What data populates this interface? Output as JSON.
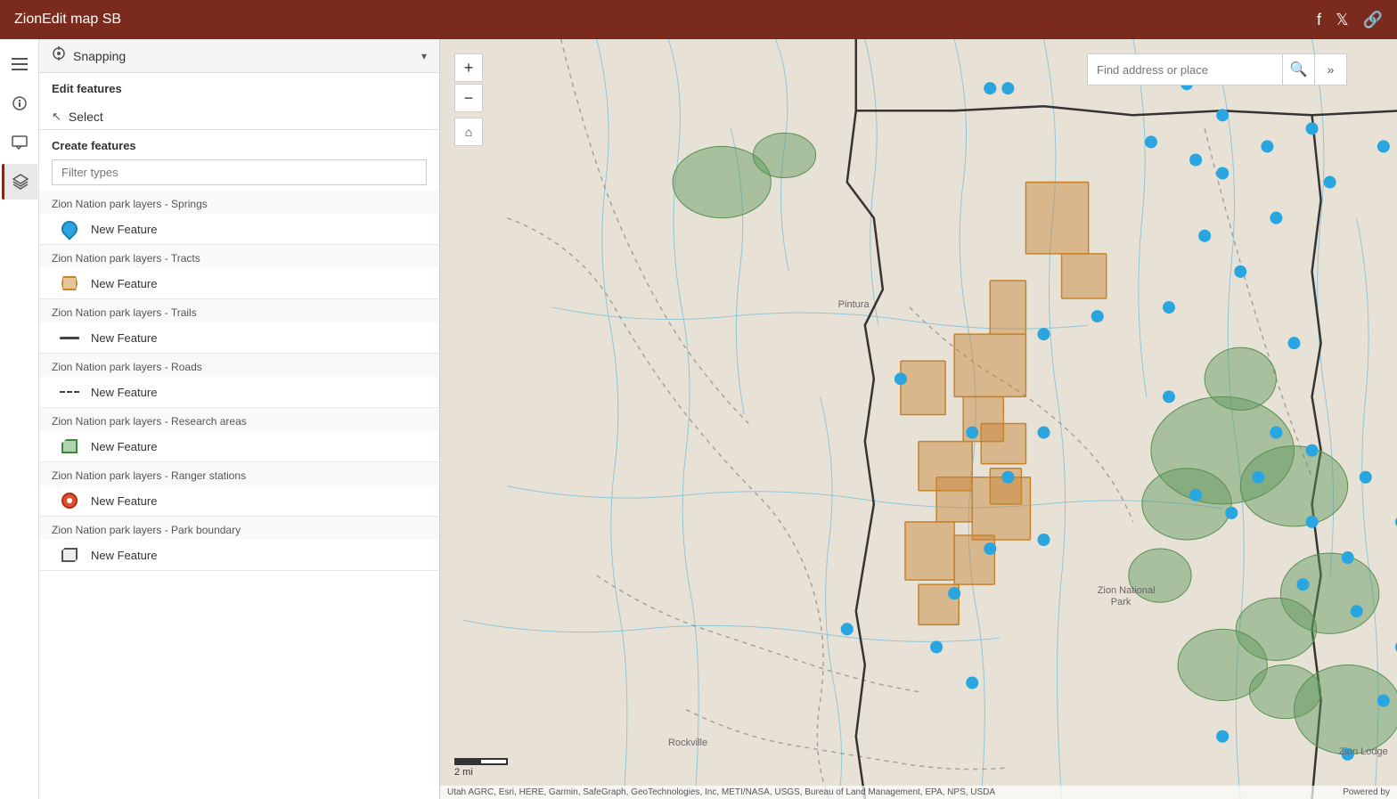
{
  "app": {
    "title": "ZionEdit map SB"
  },
  "topbar": {
    "title": "ZionEdit map SB",
    "icons": [
      "facebook",
      "twitter",
      "share"
    ]
  },
  "sidebar_icons": [
    {
      "name": "list-icon",
      "symbol": "☰"
    },
    {
      "name": "info-icon",
      "symbol": "ℹ"
    },
    {
      "name": "comment-icon",
      "symbol": "▭"
    },
    {
      "name": "layers-icon",
      "symbol": "⧉"
    }
  ],
  "panel": {
    "snapping_label": "Snapping",
    "edit_features_title": "Edit features",
    "select_label": "Select",
    "create_features_title": "Create features",
    "filter_placeholder": "Filter types",
    "layer_groups": [
      {
        "title": "Zion Nation park layers - Springs",
        "feature_label": "New Feature",
        "icon_type": "point"
      },
      {
        "title": "Zion Nation park layers - Tracts",
        "feature_label": "New Feature",
        "icon_type": "polygon-orange"
      },
      {
        "title": "Zion Nation park layers - Trails",
        "feature_label": "New Feature",
        "icon_type": "line-solid"
      },
      {
        "title": "Zion Nation park layers - Roads",
        "feature_label": "New Feature",
        "icon_type": "line-dashed"
      },
      {
        "title": "Zion Nation park layers - Research areas",
        "feature_label": "New Feature",
        "icon_type": "polygon-green"
      },
      {
        "title": "Zion Nation park layers - Ranger stations",
        "feature_label": "New Feature",
        "icon_type": "ranger"
      },
      {
        "title": "Zion Nation park layers - Park boundary",
        "feature_label": "New Feature",
        "icon_type": "boundary"
      }
    ]
  },
  "map": {
    "search_placeholder": "Find address or place",
    "zoom_in": "+",
    "zoom_out": "−",
    "home": "⌂",
    "scale_label": "2 mi",
    "attribution": "Utah AGRC, Esri, HERE, Garmin, SafeGraph, GeoTechnologies, Inc, METI/NASA, USGS, Bureau of Land Management, EPA, NPS, USDA",
    "powered_by": "Powered by"
  }
}
